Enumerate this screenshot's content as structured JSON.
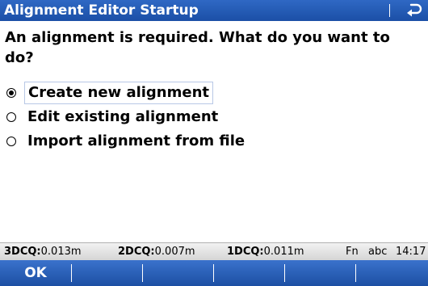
{
  "window": {
    "title": "Alignment Editor Startup",
    "back_icon": "return-arrow-icon"
  },
  "prompt": "An alignment is required. What do you want to do?",
  "options": [
    {
      "label": "Create new alignment",
      "selected": true
    },
    {
      "label": "Edit existing alignment",
      "selected": false
    },
    {
      "label": "Import alignment from file",
      "selected": false
    }
  ],
  "status": {
    "q3_label": "3DCQ:",
    "q3_value": "0.013m",
    "q2_label": "2DCQ:",
    "q2_value": "0.007m",
    "q1_label": "1DCQ:",
    "q1_value": "0.011m",
    "fn": "Fn",
    "input_mode": "abc",
    "time": "14:17"
  },
  "softkeys": [
    "OK",
    "",
    "",
    "",
    "",
    ""
  ],
  "colors": {
    "titlebar": "#1b4fa6",
    "softkeys": "#1c4fa3",
    "statusbar": "#d5d5d5",
    "selection_border": "#b8c8e6"
  }
}
